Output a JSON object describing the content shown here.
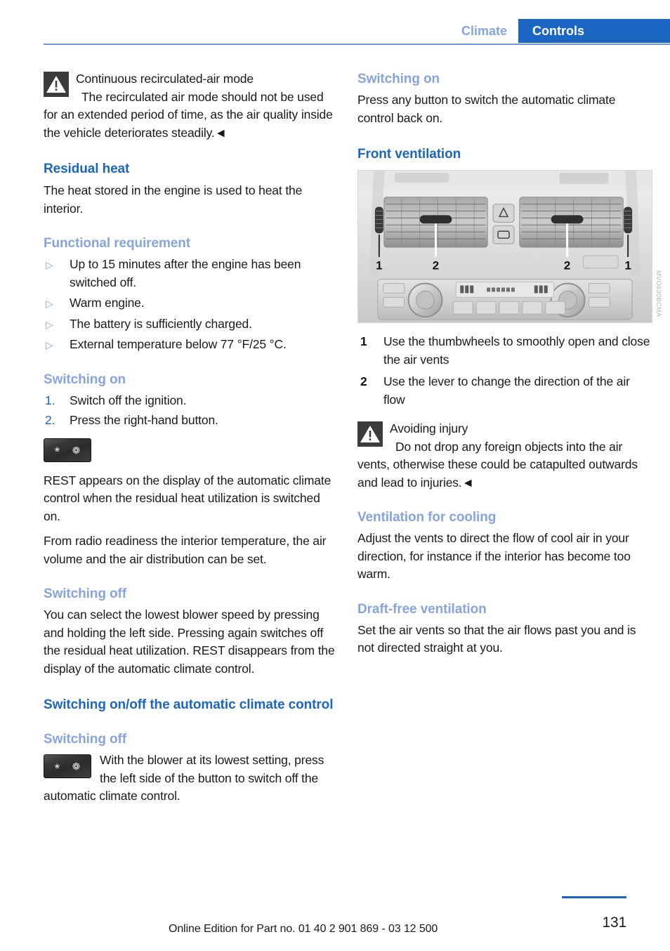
{
  "header": {
    "chapter": "Climate",
    "section": "Controls",
    "chapter_color": "#86a4e0",
    "section_bg": "#1a66c2",
    "rule_color": "#6d96d6"
  },
  "colors": {
    "heading_primary": "#1a66c2",
    "heading_secondary": "#86a4e0",
    "body_text": "#1a1a1a",
    "warning_icon_bg": "#3c3c3c"
  },
  "left_column": {
    "warning": {
      "icon": "warning-triangle-icon",
      "title": "Continuous recirculated-air mode",
      "body": "The recirculated air mode should not be used for an extended period of time, as the air quality inside the vehicle deteriorates steadily.◄"
    },
    "residual_heat": {
      "heading": "Residual heat",
      "body": "The heat stored in the engine is used to heat the interior."
    },
    "functional_requirement": {
      "heading": "Functional requirement",
      "bullet_glyph": "▷",
      "items": [
        "Up to 15 minutes after the engine has been switched off.",
        "Warm engine.",
        "The battery is sufficiently charged.",
        "External temperature below 77 °F/25 °C."
      ]
    },
    "switching_on": {
      "heading": "Switching on",
      "steps": [
        {
          "number": "1.",
          "text": "Switch off the ignition."
        },
        {
          "number": "2.",
          "text": "Press the right-hand button."
        }
      ],
      "button_icon": {
        "name": "blower-button-icon",
        "left_glyph": "❀",
        "right_glyph": "❁"
      },
      "paragraph_1": "REST appears on the display of the automatic climate control when the residual heat utilization is switched on.",
      "paragraph_2": "From radio readiness the interior temperature, the air volume and the air distribution can be set."
    },
    "switching_off": {
      "heading": "Switching off",
      "body": "You can select the lowest blower speed by pressing and holding the left side. Pressing again switches off the residual heat utilization. REST disappears from the display of the automatic climate control."
    },
    "auto_climate": {
      "heading": "Switching on/off the automatic climate control",
      "sub_heading": "Switching off",
      "button_icon": {
        "name": "blower-button-icon",
        "left_glyph": "❀",
        "right_glyph": "❁"
      },
      "body": "With the blower at its lowest setting, press the left side of the button to switch off the automatic climate control."
    }
  },
  "right_column": {
    "switching_on": {
      "heading": "Switching on",
      "body": "Press any button to switch the automatic climate control back on."
    },
    "front_ventilation": {
      "heading": "Front ventilation",
      "figure": {
        "alt": "Center console with two front air vents, callouts 1 and 2",
        "callouts": [
          "1",
          "2",
          "2",
          "1"
        ],
        "code": "MVO630BCMA"
      },
      "legend": [
        {
          "number": "1",
          "text": "Use the thumbwheels to smoothly open and close the air vents"
        },
        {
          "number": "2",
          "text": "Use the lever to change the direction of the air flow"
        }
      ],
      "warning": {
        "icon": "warning-triangle-icon",
        "title": "Avoiding injury",
        "body": "Do not drop any foreign objects into the air vents, otherwise these could be catapulted outwards and lead to injuries.◄"
      }
    },
    "ventilation_cooling": {
      "heading": "Ventilation for cooling",
      "body": "Adjust the vents to direct the flow of cool air in your direction, for instance if the interior has become too warm."
    },
    "draft_free": {
      "heading": "Draft-free ventilation",
      "body": "Set the air vents so that the air flows past you and is not directed straight at you."
    }
  },
  "footer": {
    "edition_text": "Online Edition for Part no. 01 40 2 901 869 - 03 12 500",
    "page_number": "131"
  }
}
